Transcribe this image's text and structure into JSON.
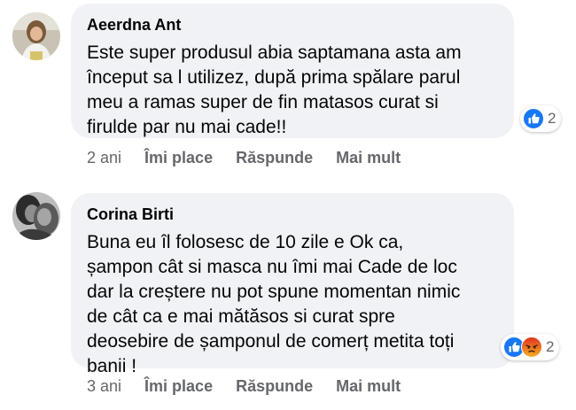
{
  "comments": [
    {
      "author": "Aeerdna Ant",
      "text": "Este super produsul abia saptamana asta am\nînceput sa l utilizez, după prima spălare parul\nmeu a ramas super de fin matasos curat si\nfirulde par nu mai cade!!",
      "reaction_icons": [
        "like-icon"
      ],
      "reaction_count": "2",
      "time": "2 ani",
      "actions": {
        "like": "Îmi place",
        "reply": "Răspunde",
        "more": "Mai mult"
      }
    },
    {
      "author": "Corina Birti",
      "text": "Buna eu îl folosesc de 10 zile e Ok ca,\nșampon cât si masca nu îmi mai Cade de loc\ndar la creștere nu pot spune momentan nimic\nde cât ca e mai mătăsos si curat spre\ndeosebire de șamponul de comerț metita toți\nbanii !",
      "reaction_icons": [
        "like-icon",
        "angry-icon"
      ],
      "reaction_count": "2",
      "time": "3 ani",
      "actions": {
        "like": "Îmi place",
        "reply": "Răspunde",
        "more": "Mai mult"
      }
    }
  ],
  "colors": {
    "bubble": "#f0f2f5",
    "like": "#1877f2",
    "angry": "#e9710f",
    "secondary_text": "#65676b"
  }
}
